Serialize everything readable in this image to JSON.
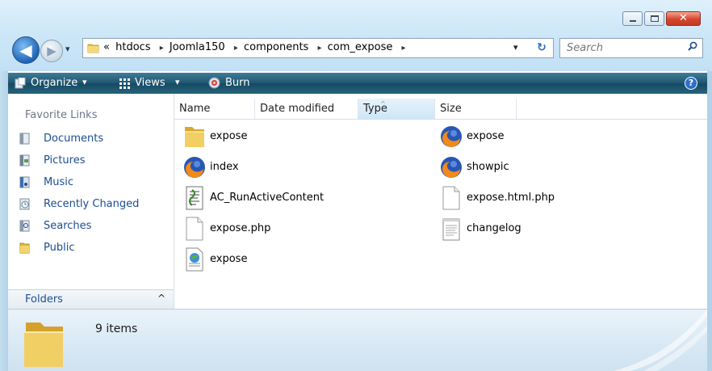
{
  "window": {
    "minimize_label": "",
    "maximize_label": "",
    "close_label": "✕"
  },
  "nav_buttons": {
    "back_glyph": "◀",
    "forward_glyph": "▶",
    "dropdown_glyph": "▾"
  },
  "address": {
    "chevron": "«",
    "crumbs": [
      "htdocs",
      "Joomla150",
      "components",
      "com_expose"
    ],
    "separator": "▸",
    "dropdown_glyph": "▾",
    "refresh_glyph": "↻"
  },
  "search": {
    "placeholder": "Search",
    "icon": "search-icon"
  },
  "toolbar": {
    "organize_label": "Organize",
    "views_label": "Views",
    "burn_label": "Burn",
    "dropdown_glyph": "▾",
    "help_glyph": "?"
  },
  "nav_pane": {
    "favorite_links_title": "Favorite Links",
    "items": [
      {
        "label": "Documents",
        "icon": "documents-icon"
      },
      {
        "label": "Pictures",
        "icon": "pictures-icon"
      },
      {
        "label": "Music",
        "icon": "music-icon"
      },
      {
        "label": "Recently Changed",
        "icon": "recently-changed-icon"
      },
      {
        "label": "Searches",
        "icon": "searches-icon"
      },
      {
        "label": "Public",
        "icon": "folder-icon"
      }
    ],
    "folders_label": "Folders",
    "folders_chevron": "^"
  },
  "columns": {
    "name": "Name",
    "date_modified": "Date modified",
    "type": "Type",
    "size": "Size",
    "sort_glyph": "^"
  },
  "files": [
    {
      "name": "expose",
      "icon": "folder-icon"
    },
    {
      "name": "index",
      "icon": "firefox-icon"
    },
    {
      "name": "AC_RunActiveContent",
      "icon": "script-icon"
    },
    {
      "name": "expose.php",
      "icon": "blank-file-icon"
    },
    {
      "name": "expose",
      "icon": "web-document-icon"
    },
    {
      "name": "expose",
      "icon": "firefox-icon"
    },
    {
      "name": "showpic",
      "icon": "firefox-icon"
    },
    {
      "name": "expose.html.php",
      "icon": "blank-file-icon"
    },
    {
      "name": "changelog",
      "icon": "text-file-icon"
    }
  ],
  "details": {
    "item_count": "9 items"
  },
  "colors": {
    "toolbar": "#1f566f",
    "link": "#1b4d92",
    "title_bg": "#cfe8f8"
  }
}
